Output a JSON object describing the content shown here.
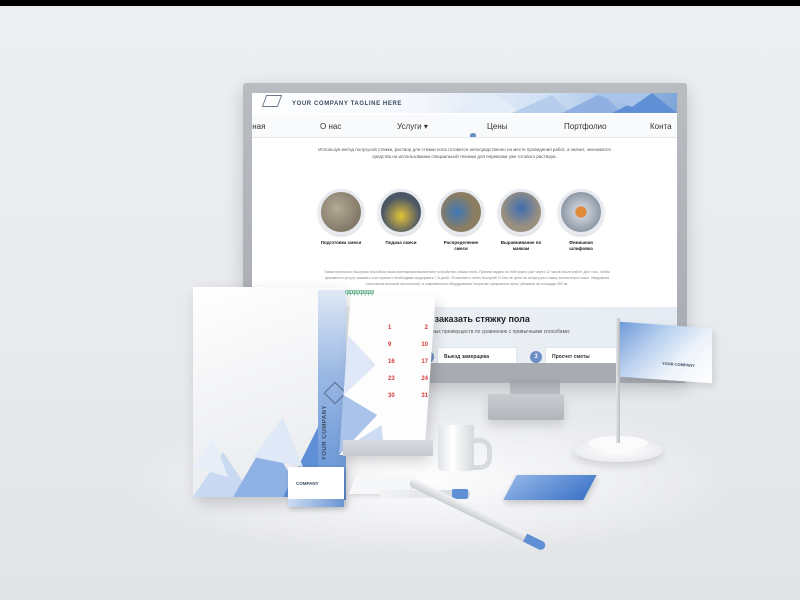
{
  "website": {
    "tagline": "YOUR COMPANY TAGLINE HERE",
    "nav": [
      "вная",
      "О нас",
      "Услуги ▾",
      "Цены",
      "Портфолио",
      "Конта"
    ],
    "intro": "Используя метод полусухой стяжки, раствор для стяжки пола готовится непосредственно на месте проведения работ, а значит, экономится средства на использовании специальной техники для перевозки уже готового раствора.",
    "steps": [
      {
        "label": "Подготовка смеси",
        "color": "#8a7f6e"
      },
      {
        "label": "Подача смеси",
        "color": "#5c6a7c"
      },
      {
        "label": "Распределение смеси",
        "color": "#7a6f58"
      },
      {
        "label": "Выравнивание по маякам",
        "color": "#4e6f9e"
      },
      {
        "label": "Финишная шлифовка",
        "color": "#9aa6b4"
      }
    ],
    "description": "Таким простым и быстрым способом наши монтажники выполняют устройство стяжки пола. Причем задать по ней нужно уже через 12 часов после работ. Для того, чтобы произвести услугу заказать она горизонт необходимо выдержать 7-8 дней. Остановить очень быстрой! И тем не цена на полусухую стяжку значительно ниже. Уведомляя отличается высокой прочностью, в современном оборудовании покрытие прекрасное цены обожаем на площади 300 кв.",
    "lower_title": "Как заказать стяжку пола",
    "lower_subtitle": "определенных преимуществ по сравнению с привычными способами:",
    "cards": [
      {
        "num": "2",
        "label": "Выезд замерщика"
      },
      {
        "num": "3",
        "label": "Просчет сметы"
      }
    ]
  },
  "calendar": {
    "rows": [
      [
        "1",
        "2"
      ],
      [
        "9",
        "10"
      ],
      [
        "16",
        "17"
      ],
      [
        "23",
        "24"
      ],
      [
        "30",
        "31"
      ]
    ],
    "rings": "φφφφφφφφ"
  },
  "folder": {
    "vertical_text": "YOUR COMPANY"
  },
  "bizcard": {
    "text": "COMPANY"
  },
  "flag": {
    "text": "YOUR COMPANY"
  },
  "colors": {
    "accent": "#5f8fd4",
    "accent_light": "#cddcf2",
    "calendar_red": "#d23b3b"
  }
}
